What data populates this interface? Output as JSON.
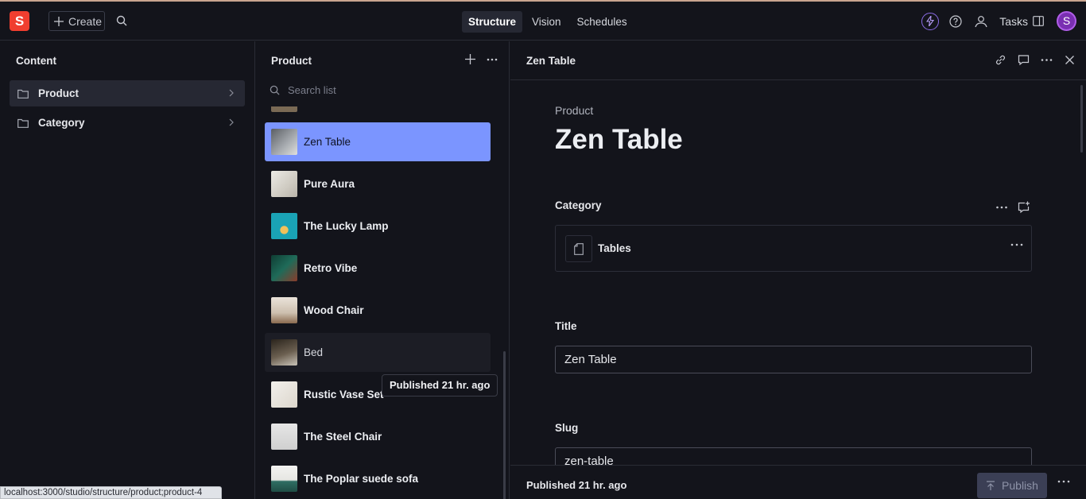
{
  "navbar": {
    "logo_text": "S",
    "create_label": "Create",
    "tabs": [
      {
        "label": "Structure",
        "active": true
      },
      {
        "label": "Vision",
        "active": false
      },
      {
        "label": "Schedules",
        "active": false
      }
    ],
    "tasks_label": "Tasks",
    "avatar_initial": "S"
  },
  "content_pane": {
    "title": "Content",
    "items": [
      {
        "label": "Product",
        "active": true
      },
      {
        "label": "Category",
        "active": false
      }
    ]
  },
  "product_pane": {
    "title": "Product",
    "search_placeholder": "Search list",
    "items": [
      {
        "label": "Zen Table",
        "state": "selected",
        "thumb_color": "#8b8f94"
      },
      {
        "label": "Pure Aura",
        "state": "normal",
        "thumb_color": "#d9d6cf"
      },
      {
        "label": "The Lucky Lamp",
        "state": "normal",
        "thumb_color": "#1aa3b5"
      },
      {
        "label": "Retro Vibe",
        "state": "normal",
        "thumb_color": "#1f6b59"
      },
      {
        "label": "Wood Chair",
        "state": "normal",
        "thumb_color": "#d8cfc4"
      },
      {
        "label": "Bed",
        "state": "hover",
        "thumb_color": "#4b4338"
      },
      {
        "label": "Rustic Vase Set",
        "state": "normal",
        "thumb_color": "#e9e6df"
      },
      {
        "label": "The Steel Chair",
        "state": "normal",
        "thumb_color": "#dcdcdc"
      },
      {
        "label": "The Poplar suede sofa",
        "state": "normal",
        "thumb_color": "#2f6e63"
      }
    ],
    "tooltip": "Published 21 hr. ago"
  },
  "document": {
    "header_title": "Zen Table",
    "type_label": "Product",
    "title": "Zen Table",
    "category": {
      "label": "Category",
      "value": "Tables"
    },
    "title_field": {
      "label": "Title",
      "value": "Zen Table"
    },
    "slug_field": {
      "label": "Slug",
      "value": "zen-table"
    },
    "footer_status": "Published 21 hr. ago",
    "publish_label": "Publish"
  },
  "statusbar_url": "localhost:3000/studio/structure/product;product-4",
  "colors": {
    "accent": "#7b95ff",
    "brand": "#f03e2f"
  }
}
